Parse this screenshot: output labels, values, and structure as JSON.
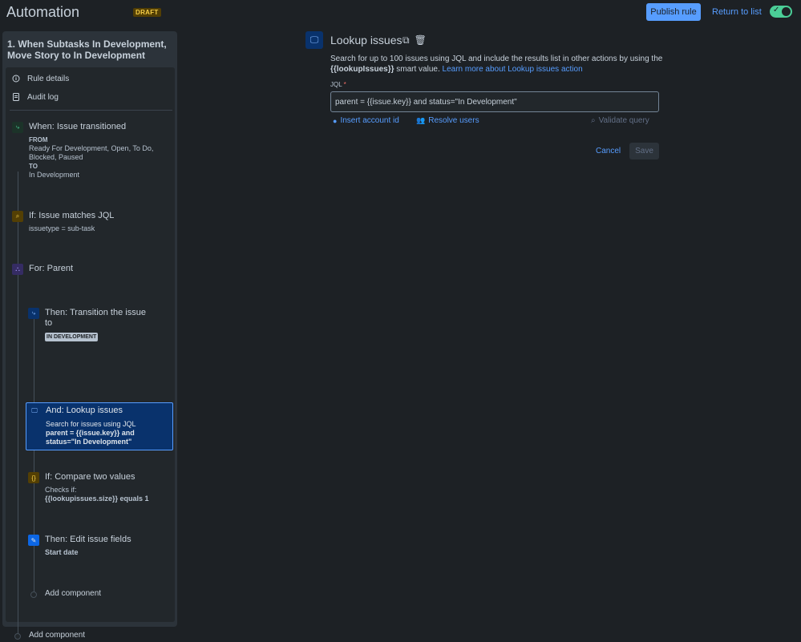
{
  "header": {
    "title": "Automation",
    "draft_badge": "DRAFT",
    "publish_label": "Publish rule",
    "return_label": "Return to list",
    "toggle_state": "on"
  },
  "rule": {
    "name": "1. When Subtasks In Development, Move Story to In Development",
    "menu": [
      {
        "label": "Rule details",
        "icon": "info-icon"
      },
      {
        "label": "Audit log",
        "icon": "document-icon"
      }
    ],
    "trigger": {
      "title": "When: Issue transitioned",
      "from_label": "FROM",
      "from_value": "Ready For Development, Open, To Do, Blocked, Paused",
      "to_label": "TO",
      "to_value": "In Development"
    },
    "condition1": {
      "title": "If: Issue matches JQL",
      "body": "issuetype = sub-task"
    },
    "branch": {
      "title": "For: Parent"
    },
    "transition": {
      "title": "Then: Transition the issue",
      "title2": "to",
      "badge": "IN DEVELOPMENT"
    },
    "lookup": {
      "title": "And: Lookup issues",
      "body": "Search for issues using JQL",
      "jql1": "parent = {{issue.key}} and",
      "jql2": "status=\"In Development\""
    },
    "compare": {
      "title": "If: Compare two values",
      "body": "Checks if:",
      "expr": "{{lookupissues.size}} equals 1"
    },
    "edit": {
      "title": "Then: Edit issue fields",
      "body": "Start date"
    },
    "add_inner": "Add component",
    "add_outer": "Add component"
  },
  "editor": {
    "title": "Lookup issues",
    "desc1": "Search for up to 100 issues using JQL and include the results list in other actions by using the",
    "desc_smart": "{{lookupIssues}}",
    "desc2": " smart value. ",
    "desc_link": "Learn more about Lookup issues action",
    "jql_label": "JQL",
    "jql_required": "*",
    "jql_value": "parent = {{issue.key}} and status=\"In Development\"",
    "insert_account": "Insert account id",
    "resolve_users": "Resolve users",
    "validate": "Validate query",
    "cancel": "Cancel",
    "save": "Save"
  },
  "colors": {
    "background": "#1d2125",
    "accent": "#579dff",
    "toggle_on": "#4bce97",
    "draft": "#f5cd47"
  }
}
